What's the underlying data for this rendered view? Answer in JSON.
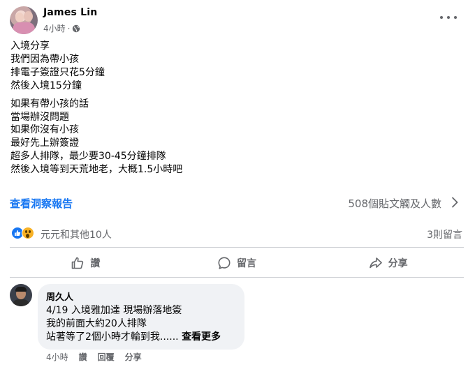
{
  "post": {
    "author": "James Lin",
    "time": "4小時",
    "separator": "·",
    "paragraphs": [
      [
        "入境分享",
        "我們因為帶小孩",
        "排電子簽證只花5分鐘",
        "然後入境15分鐘"
      ],
      [
        "如果有帶小孩的話",
        "當場辦沒問題",
        "如果你沒有小孩",
        "最好先上辦簽證",
        "超多人排隊，最少要30-45分鐘排隊",
        "然後入境等到天荒地老，大概1.5小時吧"
      ]
    ],
    "insights_link": "查看洞察報告",
    "reach": "508個貼文觸及人數",
    "reactors": "元元和其他10人",
    "comments_count": "3則留言"
  },
  "actions": {
    "like": "讚",
    "comment": "留言",
    "share": "分享"
  },
  "comment": {
    "name": "周久人",
    "lines": [
      "4/19 入境雅加達 現場辦落地簽",
      "我的前面大約20人排隊"
    ],
    "last_line": "站著等了2個小時才輪到我......",
    "see_more": "查看更多",
    "time": "4小時",
    "like": "讚",
    "reply": "回覆",
    "share": "分享"
  },
  "colors": {
    "link": "#1877f2",
    "secondary_text": "#65676b",
    "bubble": "#f0f2f5",
    "divider": "#ced0d4"
  },
  "icons": {
    "privacy": "globe-icon",
    "menu": "more-horizontal-icon",
    "insights": "chevron-right-icon",
    "like": "thumbs-up-icon",
    "comment": "speech-bubble-icon",
    "share": "share-arrow-icon",
    "reaction_1": "like-reaction-icon",
    "reaction_2": "wow-reaction-icon"
  }
}
